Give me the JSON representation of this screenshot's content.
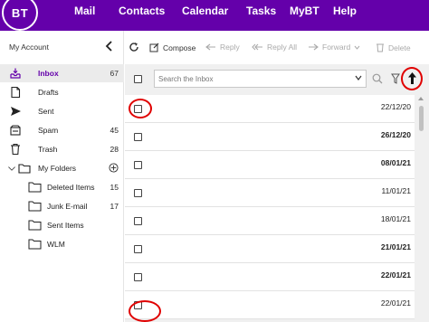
{
  "brand": {
    "logo_text": "BT"
  },
  "nav": {
    "items": [
      "Mail",
      "Contacts",
      "Calendar",
      "Tasks",
      "MyBT",
      "Help"
    ]
  },
  "sidebar": {
    "account_label": "My Account",
    "folders": [
      {
        "label": "Inbox",
        "count": "67",
        "icon": "inbox-icon",
        "selected": true
      },
      {
        "label": "Drafts",
        "count": "",
        "icon": "drafts-icon"
      },
      {
        "label": "Sent",
        "count": "",
        "icon": "send-icon"
      },
      {
        "label": "Spam",
        "count": "45",
        "icon": "spam-icon"
      },
      {
        "label": "Trash",
        "count": "28",
        "icon": "trash-icon"
      },
      {
        "label": "My Folders",
        "count": "",
        "icon": "folder-icon"
      }
    ],
    "sub_folders": [
      {
        "label": "Deleted Items",
        "count": "15"
      },
      {
        "label": "Junk E-mail",
        "count": "17"
      },
      {
        "label": "Sent Items",
        "count": ""
      },
      {
        "label": "WLM",
        "count": ""
      }
    ]
  },
  "toolbar": {
    "compose": "Compose",
    "reply": "Reply",
    "reply_all": "Reply All",
    "forward": "Forward",
    "delete": "Delete"
  },
  "search": {
    "placeholder": "Search the Inbox"
  },
  "messages": [
    {
      "date": "22/12/20",
      "bold": false
    },
    {
      "date": "26/12/20",
      "bold": true
    },
    {
      "date": "08/01/21",
      "bold": true
    },
    {
      "date": "11/01/21",
      "bold": false
    },
    {
      "date": "18/01/21",
      "bold": false
    },
    {
      "date": "21/01/21",
      "bold": true
    },
    {
      "date": "22/01/21",
      "bold": true
    },
    {
      "date": "22/01/21",
      "bold": false
    }
  ],
  "colors": {
    "brand": "#6400aa",
    "highlight_ring": "#e00000",
    "selected_bg": "#ebebeb"
  }
}
